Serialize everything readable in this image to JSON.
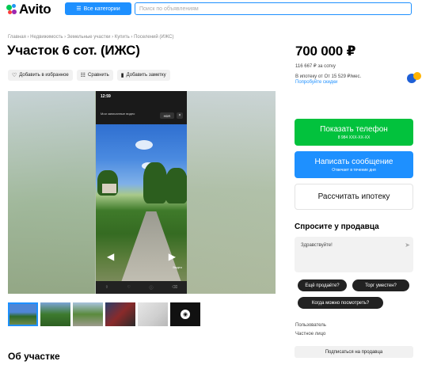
{
  "header": {
    "logo_text": "Avito",
    "categories_label": "Все категории",
    "search_placeholder": "Поиск по объявлениям"
  },
  "breadcrumb": "Главная › Недвижимость › Земельные участки › Купить › Поселений (ИЖС)",
  "listing": {
    "title": "Участок 6 сот. (ИЖС)",
    "actions": {
      "favorite": "Добавить в избранное",
      "compare": "Сравнить",
      "note": "Добавить заметку"
    }
  },
  "gallery": {
    "phone_time": "12:59",
    "phone_title": "Мои записанные видео",
    "phone_badge": "HDR",
    "phone_footer": "Видео",
    "thumbnails": [
      "photo-1",
      "photo-2",
      "photo-3",
      "photo-4",
      "photo-5",
      "more-photos"
    ]
  },
  "about_title": "Об участке",
  "sidebar": {
    "price": "700 000 ₽",
    "price_per_sotka": "116 667 ₽ за сотку",
    "mortgage_text": "В ипотеку от От 15 529 ₽/мес.",
    "discount_link": "Попробуйте скидки",
    "phone_button": "Показать телефон",
    "phone_masked": "8 984 XXX-XX-XX",
    "message_button": "Написать сообщение",
    "message_sub": "Отвечает в течение дня",
    "mortgage_button": "Рассчитать ипотеку",
    "ask_title": "Спросите у продавца",
    "ask_message": "Здравствуйте!",
    "quick_questions": [
      "Ещё продаёте?",
      "Торг уместен?",
      "Когда можно посмотреть?"
    ],
    "seller_label": "Пользователь",
    "seller_type": "Частное лицо",
    "subscribe_button": "Подписаться на продавца"
  },
  "colors": {
    "accent_blue": "#1e90ff",
    "accent_green": "#02c23d"
  }
}
